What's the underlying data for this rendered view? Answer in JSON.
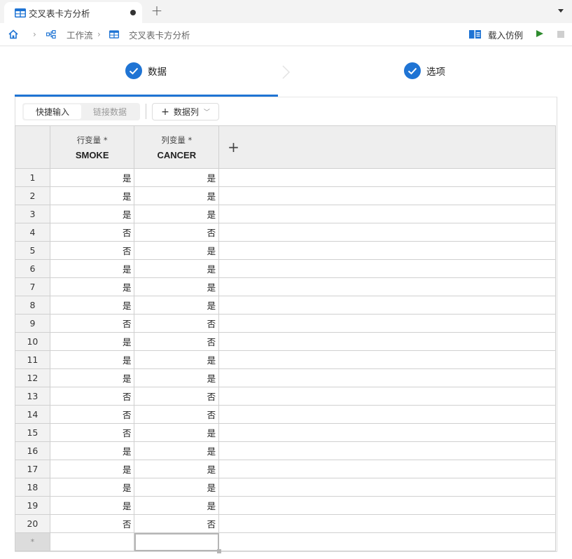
{
  "tabs": [
    {
      "title": "交叉表卡方分析",
      "icon": "table-icon",
      "modified": true
    }
  ],
  "new_tab_label": "+",
  "breadcrumb": {
    "home_icon": "home-icon",
    "items": [
      {
        "label": "工作流",
        "icon": "workflow-icon"
      },
      {
        "label": "交叉表卡方分析",
        "icon": "table-icon"
      }
    ],
    "separator": "›"
  },
  "actions": {
    "load_example": "载入仿例",
    "run_icon": "play-icon",
    "stop_icon": "stop-icon"
  },
  "steps": [
    {
      "label": "数据",
      "status": "complete",
      "active": true
    },
    {
      "label": "选项",
      "status": "complete",
      "active": false
    }
  ],
  "toolbar": {
    "segments": [
      {
        "label": "快捷输入",
        "active": true
      },
      {
        "label": "链接数据",
        "active": false
      }
    ],
    "add_column_label": "数据列"
  },
  "grid": {
    "columns": [
      {
        "role": "行变量 *",
        "name": "SMOKE"
      },
      {
        "role": "列变量 *",
        "name": "CANCER"
      }
    ],
    "add_column": "+",
    "rows": [
      {
        "n": "1",
        "smoke": "是",
        "cancer": "是"
      },
      {
        "n": "2",
        "smoke": "是",
        "cancer": "是"
      },
      {
        "n": "3",
        "smoke": "是",
        "cancer": "是"
      },
      {
        "n": "4",
        "smoke": "否",
        "cancer": "否"
      },
      {
        "n": "5",
        "smoke": "否",
        "cancer": "是"
      },
      {
        "n": "6",
        "smoke": "是",
        "cancer": "是"
      },
      {
        "n": "7",
        "smoke": "是",
        "cancer": "是"
      },
      {
        "n": "8",
        "smoke": "是",
        "cancer": "是"
      },
      {
        "n": "9",
        "smoke": "否",
        "cancer": "否"
      },
      {
        "n": "10",
        "smoke": "是",
        "cancer": "否"
      },
      {
        "n": "11",
        "smoke": "是",
        "cancer": "是"
      },
      {
        "n": "12",
        "smoke": "是",
        "cancer": "是"
      },
      {
        "n": "13",
        "smoke": "否",
        "cancer": "否"
      },
      {
        "n": "14",
        "smoke": "否",
        "cancer": "否"
      },
      {
        "n": "15",
        "smoke": "否",
        "cancer": "是"
      },
      {
        "n": "16",
        "smoke": "是",
        "cancer": "是"
      },
      {
        "n": "17",
        "smoke": "是",
        "cancer": "是"
      },
      {
        "n": "18",
        "smoke": "是",
        "cancer": "是"
      },
      {
        "n": "19",
        "smoke": "是",
        "cancer": "是"
      },
      {
        "n": "20",
        "smoke": "否",
        "cancer": "否"
      }
    ],
    "new_row_marker": "*"
  },
  "colors": {
    "accent": "#1f74d4",
    "run": "#2e8b2e",
    "header_bg": "#eeeeee",
    "grid_line": "#d0d0d0"
  }
}
